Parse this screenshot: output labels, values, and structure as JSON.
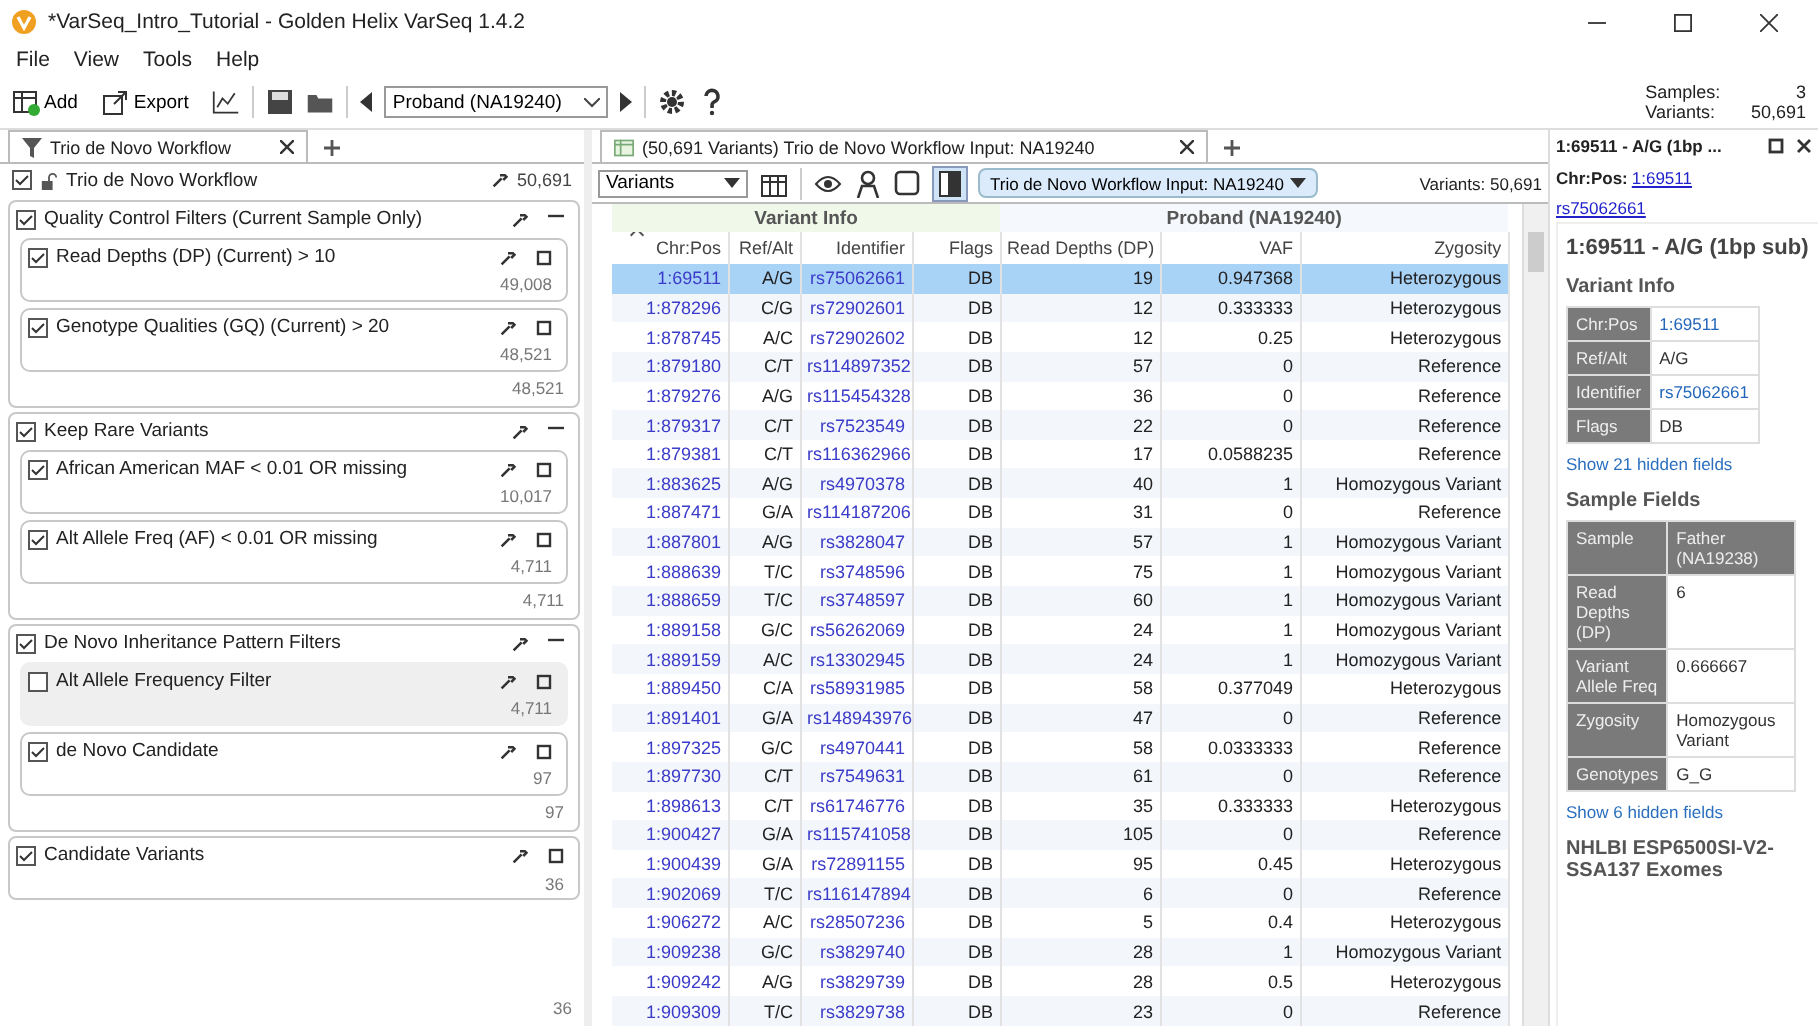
{
  "window": {
    "title": "*VarSeq_Intro_Tutorial - Golden Helix VarSeq 1.4.2"
  },
  "menu": [
    "File",
    "View",
    "Tools",
    "Help"
  ],
  "toolbar": {
    "add": "Add",
    "export": "Export",
    "sample_select": "Proband (NA19240)",
    "samples_label": "Samples:",
    "samples": "3",
    "variants_label": "Variants:",
    "variants": "50,691"
  },
  "left_tab": {
    "label": "Trio de Novo Workflow",
    "selected": true
  },
  "workflow": {
    "title": "Trio de Novo Workflow",
    "checked": true,
    "count": "50,691",
    "final_count": "36",
    "items": [
      {
        "kind": "group",
        "title": "Quality Control Filters (Current Sample Only)",
        "checked": true,
        "count": "48,521",
        "children": [
          {
            "label": "Read Depths (DP) (Current) > 10",
            "checked": true,
            "count": "49,008"
          },
          {
            "label": "Genotype Qualities (GQ) (Current) > 20",
            "checked": true,
            "count": "48,521"
          }
        ]
      },
      {
        "kind": "group",
        "title": "Keep Rare Variants",
        "checked": true,
        "count": "4,711",
        "children": [
          {
            "label": "African American MAF < 0.01 OR missing",
            "checked": true,
            "count": "10,017"
          },
          {
            "label": "Alt Allele Freq (AF) < 0.01 OR missing",
            "checked": true,
            "count": "4,711"
          }
        ]
      },
      {
        "kind": "group",
        "title": "De Novo Inheritance Pattern Filters",
        "checked": true,
        "count": "97",
        "children": [
          {
            "label": "Alt Allele Frequency Filter",
            "checked": false,
            "count": "4,711"
          },
          {
            "label": "de Novo Candidate",
            "checked": true,
            "count": "97"
          }
        ]
      },
      {
        "kind": "filter",
        "label": "Candidate Variants",
        "checked": true,
        "count": "36"
      }
    ]
  },
  "table_tab": {
    "label": "(50,691 Variants) Trio de Novo Workflow Input: NA19240",
    "selected": true
  },
  "table_toolbar": {
    "source": "Variants",
    "input": "Trio de Novo Workflow Input: NA19240",
    "variants": "Variants: 50,691"
  },
  "table": {
    "groups": [
      {
        "label": "Variant Info",
        "columns": [
          {
            "label": "Chr:Pos",
            "kind": "link",
            "sorted": true
          },
          {
            "label": "Ref/Alt",
            "kind": "text",
            "sorted": false
          },
          {
            "label": "Identifier",
            "kind": "link",
            "sorted": false
          },
          {
            "label": "Flags",
            "kind": "text",
            "sorted": false
          }
        ]
      },
      {
        "label": "Proband (NA19240)",
        "columns": [
          {
            "label": "Read Depths (DP)",
            "kind": "text",
            "sorted": false
          },
          {
            "label": "VAF",
            "kind": "text",
            "sorted": false
          },
          {
            "label": "Zygosity",
            "kind": "text",
            "sorted": false
          }
        ]
      }
    ],
    "rows": [
      {
        "selected": true,
        "cells": [
          "1:69511",
          "A/G",
          "rs75062661",
          "DB",
          "19",
          "0.947368",
          "Heterozygous"
        ]
      },
      {
        "selected": false,
        "cells": [
          "1:878296",
          "C/G",
          "rs72902601",
          "DB",
          "12",
          "0.333333",
          "Heterozygous"
        ]
      },
      {
        "selected": false,
        "cells": [
          "1:878745",
          "A/C",
          "rs72902602",
          "DB",
          "12",
          "0.25",
          "Heterozygous"
        ]
      },
      {
        "selected": false,
        "cells": [
          "1:879180",
          "C/T",
          "rs114897352",
          "DB",
          "57",
          "0",
          "Reference"
        ]
      },
      {
        "selected": false,
        "cells": [
          "1:879276",
          "A/G",
          "rs115454328",
          "DB",
          "36",
          "0",
          "Reference"
        ]
      },
      {
        "selected": false,
        "cells": [
          "1:879317",
          "C/T",
          "rs7523549",
          "DB",
          "22",
          "0",
          "Reference"
        ]
      },
      {
        "selected": false,
        "cells": [
          "1:879381",
          "C/T",
          "rs116362966",
          "DB",
          "17",
          "0.0588235",
          "Reference"
        ]
      },
      {
        "selected": false,
        "cells": [
          "1:883625",
          "A/G",
          "rs4970378",
          "DB",
          "40",
          "1",
          "Homozygous Variant"
        ]
      },
      {
        "selected": false,
        "cells": [
          "1:887471",
          "G/A",
          "rs114187206",
          "DB",
          "31",
          "0",
          "Reference"
        ]
      },
      {
        "selected": false,
        "cells": [
          "1:887801",
          "A/G",
          "rs3828047",
          "DB",
          "57",
          "1",
          "Homozygous Variant"
        ]
      },
      {
        "selected": false,
        "cells": [
          "1:888639",
          "T/C",
          "rs3748596",
          "DB",
          "75",
          "1",
          "Homozygous Variant"
        ]
      },
      {
        "selected": false,
        "cells": [
          "1:888659",
          "T/C",
          "rs3748597",
          "DB",
          "60",
          "1",
          "Homozygous Variant"
        ]
      },
      {
        "selected": false,
        "cells": [
          "1:889158",
          "G/C",
          "rs56262069",
          "DB",
          "24",
          "1",
          "Homozygous Variant"
        ]
      },
      {
        "selected": false,
        "cells": [
          "1:889159",
          "A/C",
          "rs13302945",
          "DB",
          "24",
          "1",
          "Homozygous Variant"
        ]
      },
      {
        "selected": false,
        "cells": [
          "1:889450",
          "C/A",
          "rs58931985",
          "DB",
          "58",
          "0.377049",
          "Heterozygous"
        ]
      },
      {
        "selected": false,
        "cells": [
          "1:891401",
          "G/A",
          "rs148943976",
          "DB",
          "47",
          "0",
          "Reference"
        ]
      },
      {
        "selected": false,
        "cells": [
          "1:897325",
          "G/C",
          "rs4970441",
          "DB",
          "58",
          "0.0333333",
          "Reference"
        ]
      },
      {
        "selected": false,
        "cells": [
          "1:897730",
          "C/T",
          "rs7549631",
          "DB",
          "61",
          "0",
          "Reference"
        ]
      },
      {
        "selected": false,
        "cells": [
          "1:898613",
          "C/T",
          "rs61746776",
          "DB",
          "35",
          "0.333333",
          "Heterozygous"
        ]
      },
      {
        "selected": false,
        "cells": [
          "1:900427",
          "G/A",
          "rs115741058",
          "DB",
          "105",
          "0",
          "Reference"
        ]
      },
      {
        "selected": false,
        "cells": [
          "1:900439",
          "G/A",
          "rs72891155",
          "DB",
          "95",
          "0.45",
          "Heterozygous"
        ]
      },
      {
        "selected": false,
        "cells": [
          "1:902069",
          "T/C",
          "rs116147894",
          "DB",
          "6",
          "0",
          "Reference"
        ]
      },
      {
        "selected": false,
        "cells": [
          "1:906272",
          "A/C",
          "rs28507236",
          "DB",
          "5",
          "0.4",
          "Heterozygous"
        ]
      },
      {
        "selected": false,
        "cells": [
          "1:909238",
          "G/C",
          "rs3829740",
          "DB",
          "28",
          "1",
          "Homozygous Variant"
        ]
      },
      {
        "selected": false,
        "cells": [
          "1:909242",
          "A/G",
          "rs3829739",
          "DB",
          "28",
          "0.5",
          "Heterozygous"
        ]
      },
      {
        "selected": false,
        "cells": [
          "1:909309",
          "T/C",
          "rs3829738",
          "DB",
          "23",
          "0",
          "Reference"
        ]
      }
    ]
  },
  "detail": {
    "title": "1:69511 - A/G (1bp ...",
    "chrpos_label": "Chr:Pos:",
    "chrpos": "1:69511",
    "identifier": "rs75062661",
    "heading": "1:69511 - A/G (1bp sub)",
    "variant_info": {
      "title": "Variant Info",
      "more": "Show 21 hidden fields",
      "fields": [
        {
          "label": "Chr:Pos",
          "value": "1:69511",
          "kind": "link"
        },
        {
          "label": "Ref/Alt",
          "value": "A/G",
          "kind": "text"
        },
        {
          "label": "Identifier",
          "value": "rs75062661",
          "kind": "link"
        },
        {
          "label": "Flags",
          "value": "DB",
          "kind": "text"
        }
      ]
    },
    "sample_fields": {
      "title": "Sample Fields",
      "more": "Show 6 hidden fields",
      "header": [
        "Sample",
        "Father (NA19238)"
      ],
      "rows": [
        {
          "label": "Read Depths (DP)",
          "value": "6"
        },
        {
          "label": "Variant Allele Freq",
          "value": "0.666667"
        },
        {
          "label": "Zygosity",
          "value": "Homozygous Variant"
        },
        {
          "label": "Genotypes",
          "value": "G_G"
        }
      ]
    },
    "next_section": "NHLBI ESP6500SI-V2-SSA137 Exomes"
  }
}
